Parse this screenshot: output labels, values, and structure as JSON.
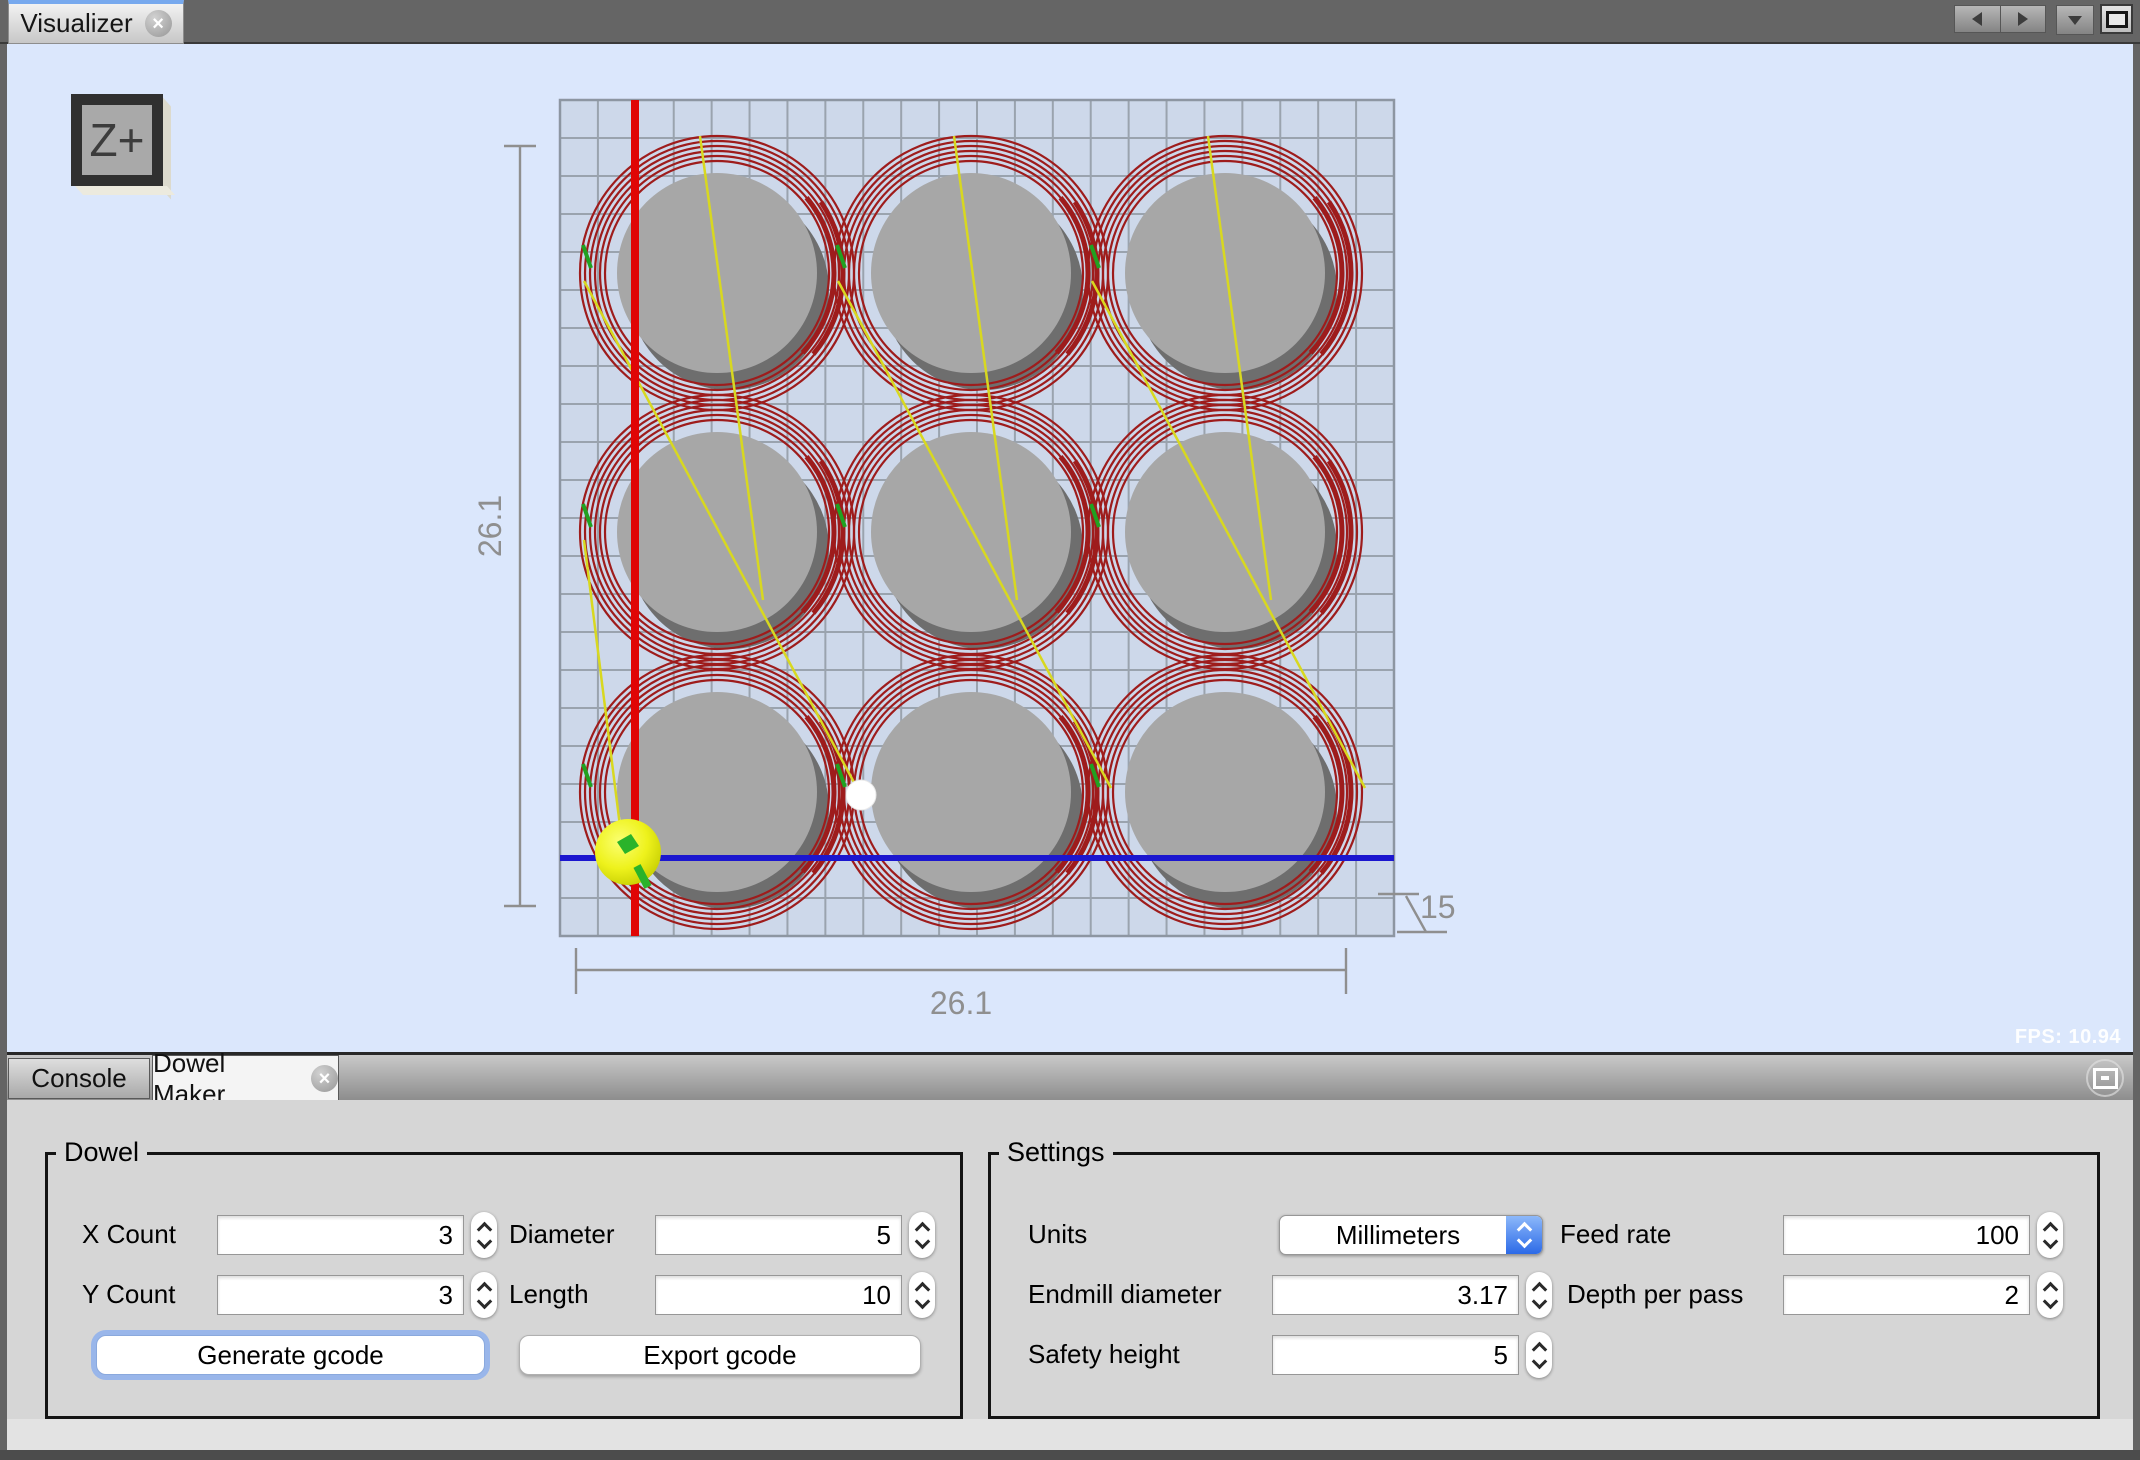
{
  "window": {
    "top_tabs": [
      {
        "label": "Visualizer"
      }
    ]
  },
  "visualizer": {
    "view_cube_label": "Z+",
    "fps": "FPS: 10.94",
    "dimensions": {
      "height_label": "26.1",
      "width_label": "26.1",
      "depth_label": "15"
    }
  },
  "dock": {
    "tabs": [
      {
        "label": "Console",
        "active": false
      },
      {
        "label": "Dowel Maker",
        "active": true
      }
    ]
  },
  "dowel_panel": {
    "title": "Dowel",
    "x_count": {
      "label": "X Count",
      "value": "3"
    },
    "y_count": {
      "label": "Y Count",
      "value": "3"
    },
    "diameter": {
      "label": "Diameter",
      "value": "5"
    },
    "length": {
      "label": "Length",
      "value": "10"
    },
    "generate_label": "Generate gcode",
    "export_label": "Export gcode"
  },
  "settings_panel": {
    "title": "Settings",
    "units": {
      "label": "Units",
      "value": "Millimeters"
    },
    "feed_rate": {
      "label": "Feed rate",
      "value": "100"
    },
    "endmill_diameter": {
      "label": "Endmill diameter",
      "value": "3.17"
    },
    "depth_per_pass": {
      "label": "Depth per pass",
      "value": "2"
    },
    "safety_height": {
      "label": "Safety height",
      "value": "5"
    }
  },
  "icons": {
    "tab_close": "×"
  },
  "colors": {
    "canvas_bg": "#dbe7fc",
    "stock_grid": "#cdd8ea",
    "toolpath_red": "#9e1c1c",
    "axis_x_blue": "#1b16cf",
    "axis_y_red": "#e00505",
    "rapid_yellow": "#d8d820",
    "tool_yellow": "#e8ee32",
    "accent_blue": "#2c6ae7"
  }
}
